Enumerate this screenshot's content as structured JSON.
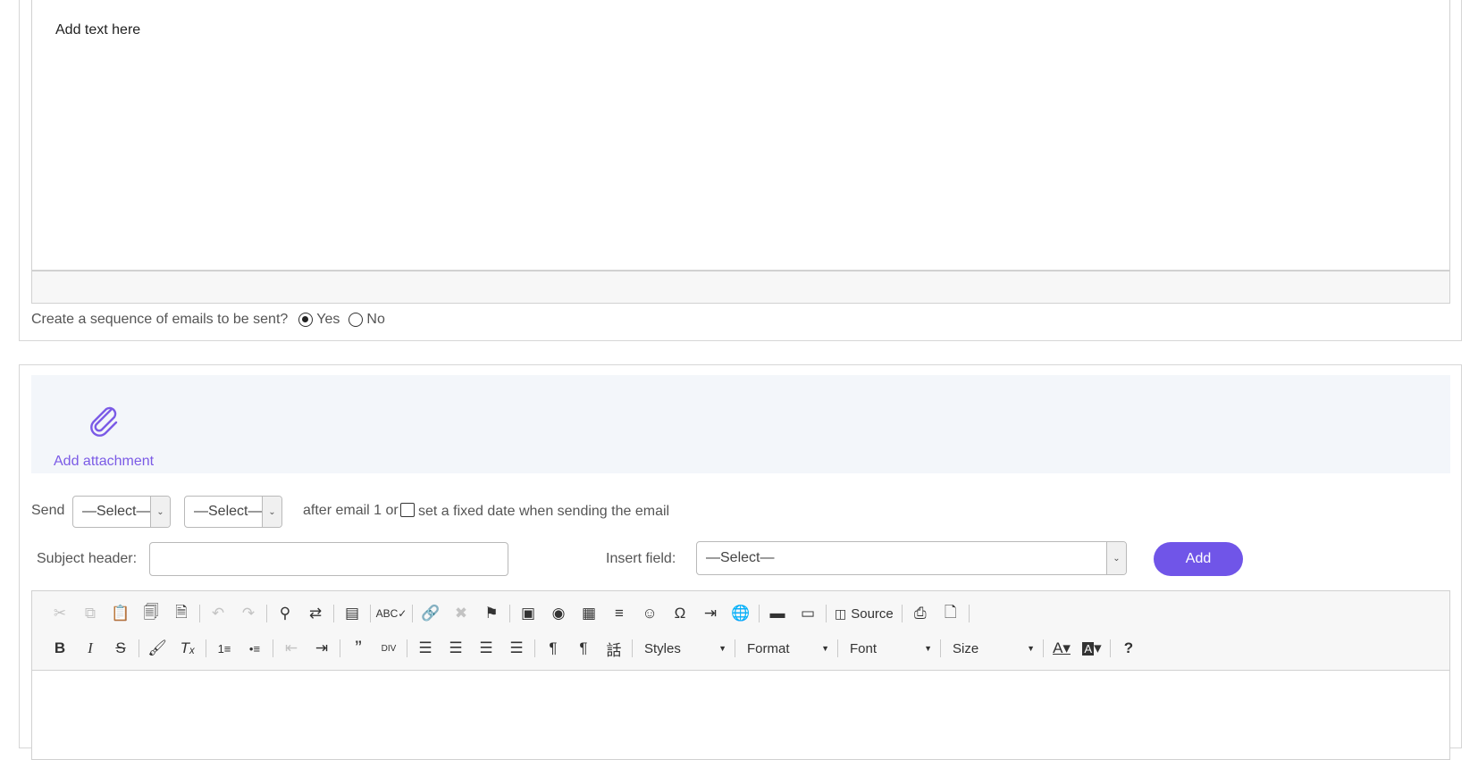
{
  "editor_top": {
    "body_text": "Add text here"
  },
  "sequence": {
    "question": "Create a sequence of emails to be sent?",
    "options": [
      {
        "label": "Yes",
        "selected": true
      },
      {
        "label": "No",
        "selected": false
      }
    ]
  },
  "attachment": {
    "label": "Add attachment",
    "icon": "paperclip-icon",
    "accent_color": "#7b5be6"
  },
  "send_row": {
    "send_label": "Send",
    "select1_value": "—Select—",
    "select2_value": "—Select—",
    "after_text": "after email 1 or",
    "fixed_date_label": "set a fixed date when sending the email",
    "fixed_date_checked": false
  },
  "subject_row": {
    "subject_label": "Subject header:",
    "subject_value": "",
    "insert_label": "Insert field:",
    "insert_value": "—Select—",
    "add_button": "Add",
    "button_color": "#7055e8"
  },
  "toolbar": {
    "source_label": "Source",
    "styles_label": "Styles",
    "format_label": "Format",
    "font_label": "Font",
    "size_label": "Size"
  }
}
